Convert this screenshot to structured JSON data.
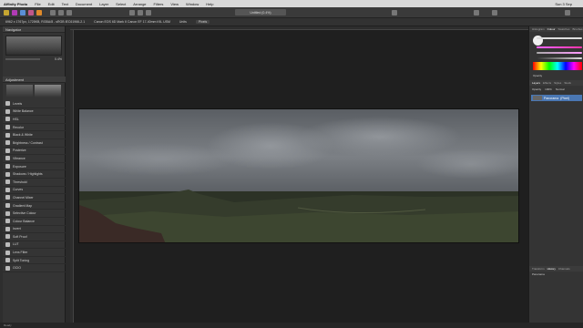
{
  "menubar": {
    "app": "Affinity Photo",
    "items": [
      "File",
      "Edit",
      "Text",
      "Document",
      "Layer",
      "Select",
      "Arrange",
      "Filters",
      "View",
      "Window",
      "Help"
    ],
    "clock": "Sun 3 Sep"
  },
  "toolbar": {
    "document_tab": "Untitled (0.4%)"
  },
  "contextbar": {
    "info_left": "6962 x 1767px, 1728KB, RGBA/8 - sRGB IEC61966-2.1",
    "info_right": "Canon EOS 6D Mark II  Canon EF 17-40mm f/4L USM",
    "units_label": "Units",
    "units_value": "Pixels"
  },
  "left_panel": {
    "navigator_title": "Navigator",
    "zoom_value": "0.4%",
    "adjustments_title": "Adjustment",
    "presets_label": "Default",
    "adjustments": [
      "Levels",
      "White Balance",
      "HSL",
      "Recolor",
      "Black & White",
      "Brightness / Contrast",
      "Posterize",
      "Vibrance",
      "Exposure",
      "Shadows / Highlights",
      "Threshold",
      "Curves",
      "Channel Mixer",
      "Gradient Map",
      "Selective Colour",
      "Colour Balance",
      "Invert",
      "Soft Proof",
      "LUT",
      "Lens Filter",
      "Split Toning",
      "OCIO"
    ]
  },
  "right_panel": {
    "top_tabs": [
      "Histogram",
      "Colour",
      "Swatches",
      "Brushes"
    ],
    "opacity_label": "Opacity",
    "layers_tabs": [
      "Layers",
      "Effects",
      "Styles",
      "Stock"
    ],
    "layer_opacity_label": "Opacity",
    "layer_opacity_value": "100%",
    "blend_mode": "Normal",
    "layer_name": "Panorama",
    "layer_type": "(Pixel)",
    "bottom_tabs": [
      "Transform",
      "History",
      "Channels"
    ],
    "history_label": "Panorama"
  },
  "statusbar": {
    "text": "Ready"
  },
  "colors": {
    "menubar": "#d9d9d9",
    "accent_selection": "#4a77b3",
    "canvas_bg": "#1f1f1f",
    "panel_bg": "#343434"
  }
}
